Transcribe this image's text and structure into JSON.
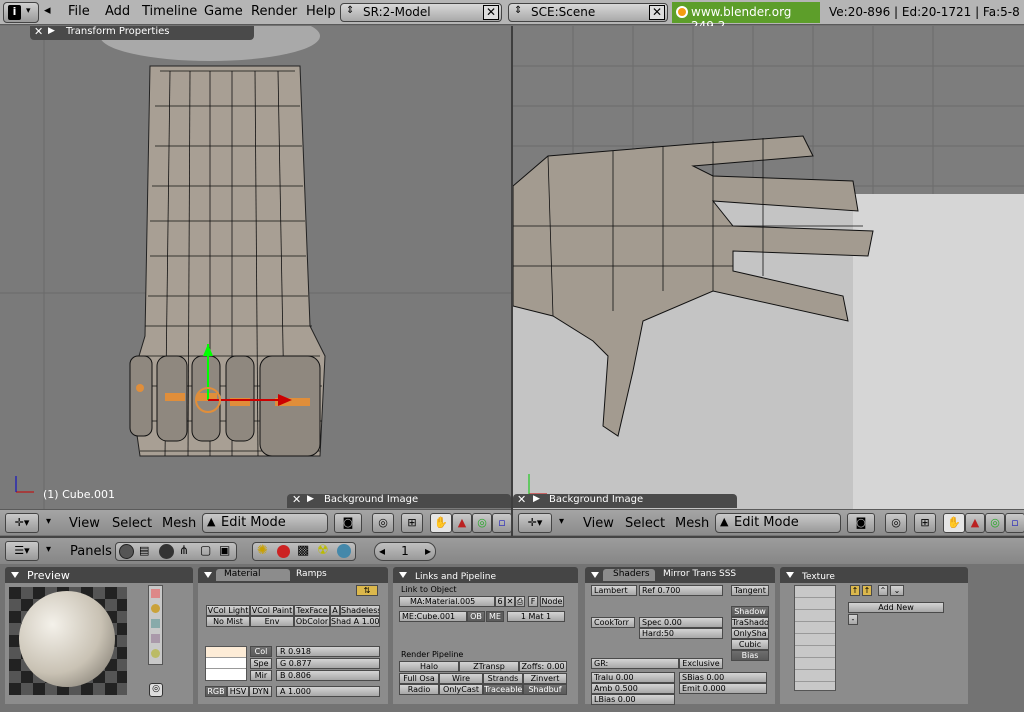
{
  "topbar": {
    "menus": [
      "File",
      "Add",
      "Timeline",
      "Game",
      "Render",
      "Help"
    ],
    "screen": "SR:2-Model",
    "scene": "SCE:Scene",
    "url": "www.blender.org 249.2",
    "stats": "Ve:20-896 | Ed:20-1721 | Fa:5-8"
  },
  "left_view": {
    "panel_title": "Transform Properties",
    "bg_panel": "Background Image",
    "object_label": "(1) Cube.001",
    "menu": [
      "View",
      "Select",
      "Mesh"
    ],
    "mode": "Edit Mode"
  },
  "right_view": {
    "bg_panel": "Background Image",
    "menu": [
      "View",
      "Select",
      "Mesh"
    ],
    "mode": "Edit Mode"
  },
  "buttons_header": {
    "panels_label": "Panels",
    "frame": "1"
  },
  "preview": {
    "title": "Preview"
  },
  "material": {
    "tab1": "Material",
    "tab2": "Ramps",
    "row1": [
      "VCol Light",
      "VCol Paint",
      "TexFace",
      "Shadeless"
    ],
    "row2": [
      "No Mist",
      "Env",
      "ObColor",
      "Shad A 1.00"
    ],
    "col_labels": [
      "Col",
      "Spe",
      "Mir"
    ],
    "r": "R 0.918",
    "g": "G 0.877",
    "b": "B 0.806",
    "modes": [
      "RGB",
      "HSV",
      "DYN"
    ],
    "alpha": "A 1.000",
    "row1_a": "A"
  },
  "links": {
    "title": "Links and Pipeline",
    "link_obj": "Link to Object",
    "ma": "MA:Material.005",
    "ma_num": "6",
    "f_btn": "F",
    "node_btn": "Node",
    "me": "ME:Cube.001",
    "ob": "OB",
    "me_btn": "ME",
    "mat_count": "1 Mat 1",
    "render_pipeline": "Render Pipeline",
    "rp_row1": [
      "Halo",
      "ZTransp",
      "Zoffs: 0.00"
    ],
    "rp_row2": [
      "Full Osa",
      "Wire",
      "Strands",
      "Zinvert"
    ],
    "rp_row3": [
      "Radio",
      "OnlyCast",
      "Traceable",
      "Shadbuf"
    ]
  },
  "shaders": {
    "title": "Shaders",
    "tab2": "Mirror Trans",
    "tab3": "SSS",
    "diffuse": "Lambert",
    "ref": "Ref  0.700",
    "tangent": "Tangent",
    "spec_type": "CookTorr",
    "spec": "Spec 0.00",
    "hard": "Hard:50",
    "right_col": [
      "Shadow",
      "TraShado",
      "OnlySha",
      "Cubic",
      "Bias"
    ],
    "gr": "GR:",
    "exclusive": "Exclusive",
    "tralu": "Tralu 0.00",
    "sbias": "SBias 0.00",
    "amb": "Amb 0.500",
    "emit": "Emit 0.000",
    "lbias": "LBias 0.00"
  },
  "texture": {
    "title": "Texture",
    "add_new": "Add New"
  },
  "accent": "#e67e22"
}
